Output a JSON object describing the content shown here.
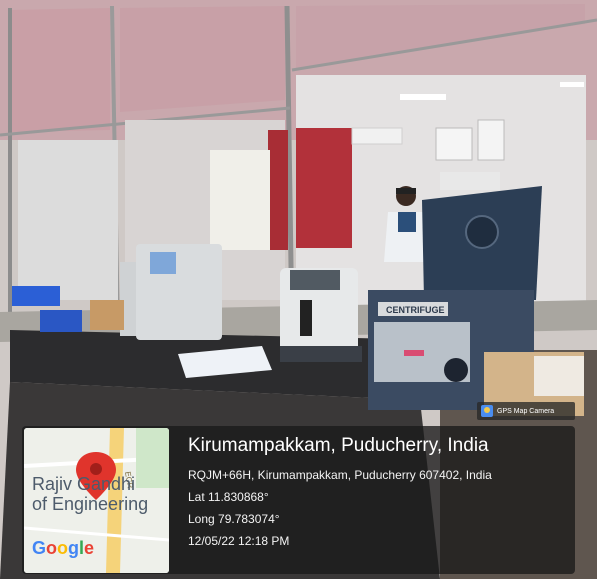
{
  "badge": {
    "text": "GPS Map Camera",
    "icon": "gps-map-camera-icon"
  },
  "location": {
    "title": "Kirumampakkam, Puducherry, India",
    "address": "RQJM+66H, Kirumampakkam, Puducherry 607402, India",
    "lat": "Lat 11.830868°",
    "long": "Long 79.783074°",
    "datetime": "12/05/22 12:18 PM"
  },
  "map": {
    "place_line1": "Rajiv Gandhi",
    "place_line2": "of Engineering",
    "road_label": "ECR",
    "brand": "Google",
    "pin_color": "#e0342c"
  },
  "photo": {
    "centrifuge_label": "CENTRIFUGE"
  }
}
